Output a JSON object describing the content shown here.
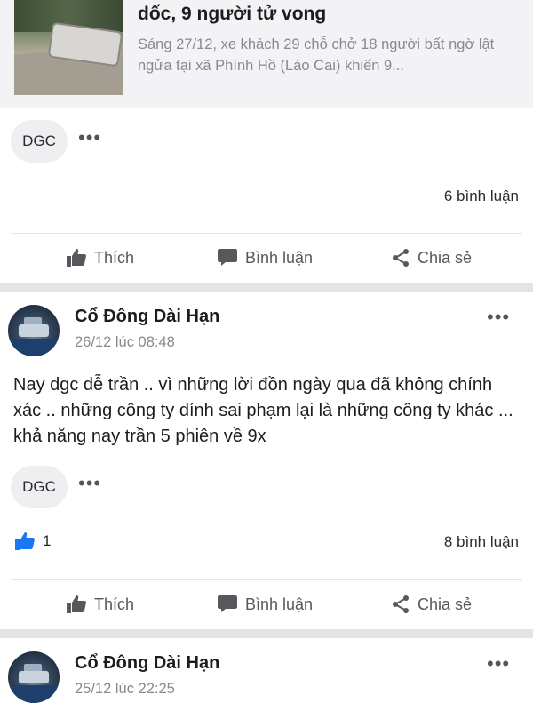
{
  "preview": {
    "title": "dốc, 9 người tử vong",
    "description": "Sáng 27/12, xe khách 29 chỗ chở 18 người bất ngờ lật ngửa tại xã Phình Hồ (Lào Cai) khiến 9..."
  },
  "post0": {
    "tag": "DGC",
    "comments": "6 bình luận"
  },
  "actions": {
    "like": "Thích",
    "comment": "Bình luận",
    "share": "Chia sẻ"
  },
  "post1": {
    "author": "Cổ Đông Dài Hạn",
    "time": "26/12 lúc 08:48",
    "body": "Nay dgc dễ trần .. vì những lời đồn ngày qua đã không chính xác .. những công ty dính sai phạm lại là những công ty khác ... khả năng nay trần 5 phiên về 9x",
    "tag": "DGC",
    "likes": "1",
    "comments": "8 bình luận"
  },
  "post2": {
    "author": "Cổ Đông Dài Hạn",
    "time": "25/12 lúc 22:25"
  },
  "colors": {
    "like_blue": "#1877f2",
    "separator": "#e4e4e6",
    "muted_text": "#8a8a8e"
  }
}
